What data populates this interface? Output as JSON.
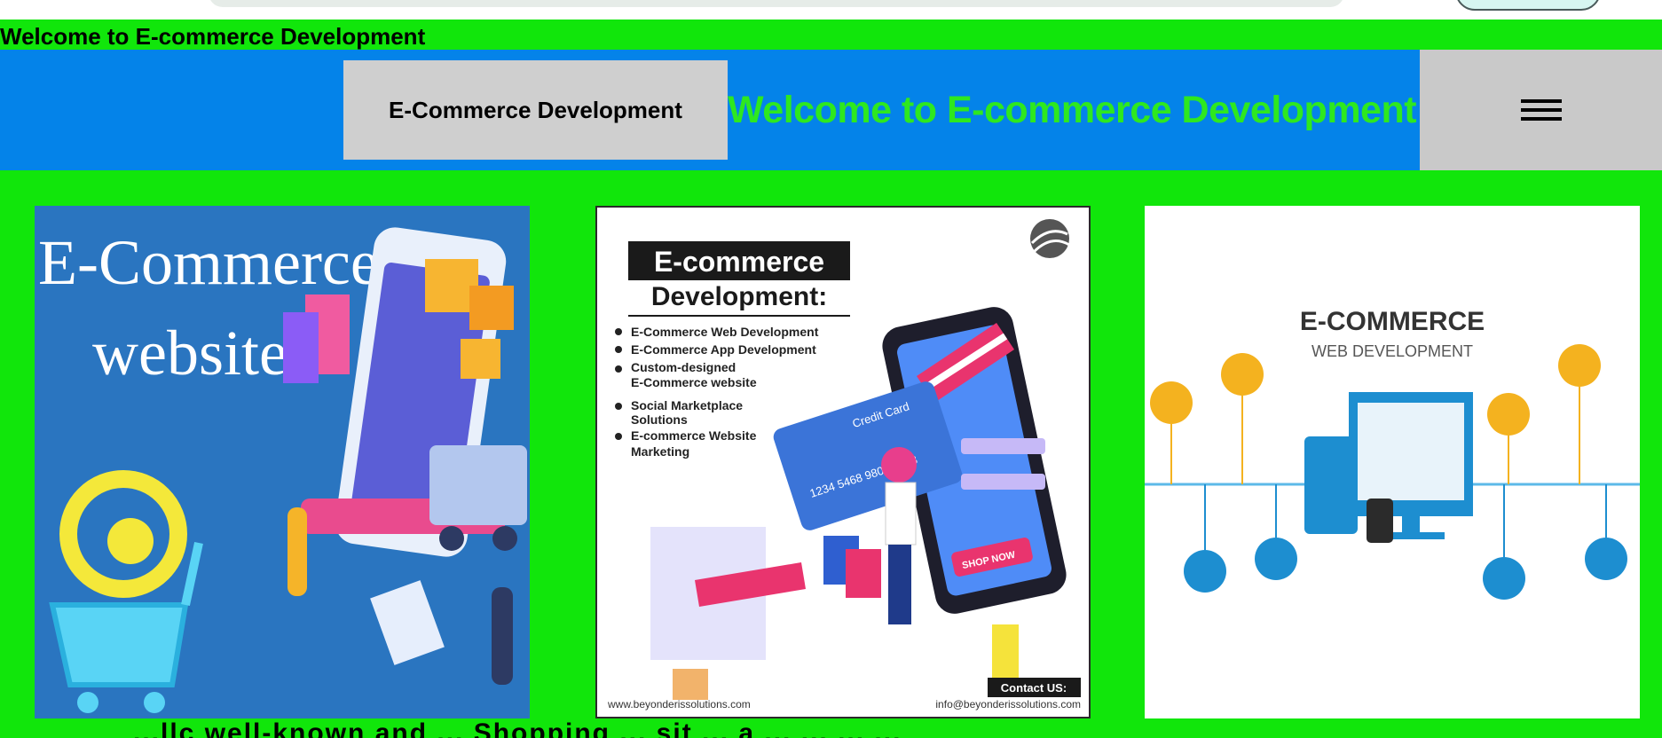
{
  "top_bar": {
    "title": "Welcome to E-commerce Development"
  },
  "header": {
    "brand_label": "E-Commerce Development",
    "welcome_text": "Welcome to E-commerce Development",
    "menu_icon": "hamburger-menu-icon",
    "colors": {
      "header_bg": "#0483e9",
      "welcome_text": "#2ee81f",
      "page_bg": "#11e60b",
      "button_bg": "#cfcfcf"
    }
  },
  "cards": [
    {
      "image_text_line1": "E-Commerce",
      "image_text_line2": "website"
    },
    {
      "image_title_line1": "E-commerce",
      "image_title_line2": "Development:",
      "bullets": [
        "E-Commerce Web Development",
        "E-Commerce App Development",
        "Custom-designed",
        "E-Commerce website",
        "Social Marketplace",
        "Solutions",
        "E-commerce Website",
        "Marketing"
      ],
      "card_label": "Credit Card",
      "card_number": "1234 5468 9801 1213",
      "shop_label": "SHOP NOW",
      "contact_label": "Contact US:",
      "footer_left": "www.beyonderissolutions.com",
      "footer_right": "info@beyonderissolutions.com"
    },
    {
      "image_title": "E-COMMERCE",
      "image_subtitle": "WEB DEVELOPMENT"
    }
  ],
  "bottom_text": "...llc well-known and ... Shopping ... sit ... a ... ... ... ..."
}
